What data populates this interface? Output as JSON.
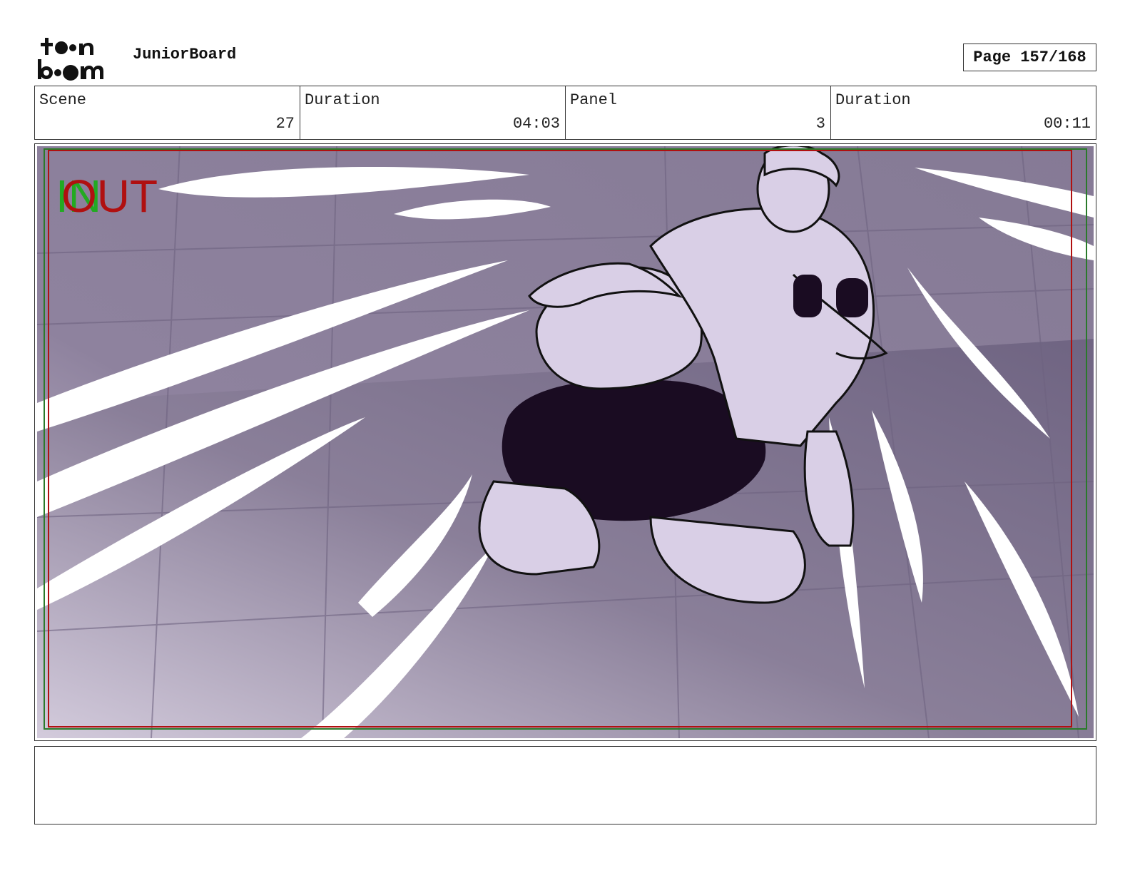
{
  "header": {
    "logo_text_top": "toon",
    "logo_text_bottom": "boom",
    "app_name": "JuniorBoard",
    "page_label": "Page 157/168"
  },
  "info": {
    "scene_label": "Scene",
    "scene_value": "27",
    "scene_duration_label": "Duration",
    "scene_duration_value": "04:03",
    "panel_label": "Panel",
    "panel_value": "3",
    "panel_duration_label": "Duration",
    "panel_duration_value": "00:11"
  },
  "panel": {
    "in_marker": "IN",
    "out_marker": "OUT",
    "colors": {
      "background": "#8a7f98",
      "floor": "#756a86",
      "figure_fill": "#d9cfe6",
      "shadow": "#1a0c22",
      "in_marker": "#22aa22",
      "out_marker": "#b01010",
      "safe_frame_red": "#b01010",
      "safe_frame_green": "#2a7a2a"
    }
  },
  "caption": {
    "text": ""
  }
}
